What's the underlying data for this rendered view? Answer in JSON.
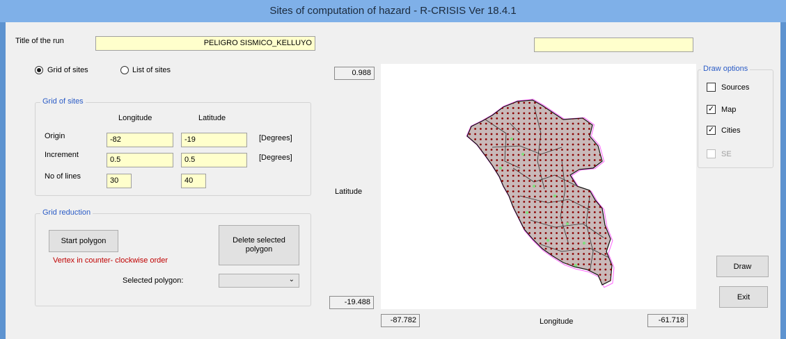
{
  "window": {
    "title": "Sites of computation of hazard - R-CRISIS Ver 18.4.1"
  },
  "run": {
    "label": "Title of the run",
    "value": "PELIGRO SISMICO_KELLUYO",
    "secondary_value": ""
  },
  "mode": {
    "grid_label": "Grid of sites",
    "list_label": "List of sites",
    "selected": "grid"
  },
  "grid": {
    "title": "Grid of sites",
    "col_longitude": "Longitude",
    "col_latitude": "Latitude",
    "rows": [
      {
        "label": "Origin",
        "lon": "-82",
        "lat": "-19",
        "unit": "[Degrees]"
      },
      {
        "label": "Increment",
        "lon": "0.5",
        "lat": "0.5",
        "unit": "[Degrees]"
      },
      {
        "label": "No of lines",
        "lon": "30",
        "lat": "40",
        "unit": ""
      }
    ]
  },
  "reduction": {
    "title": "Grid reduction",
    "start_polygon": "Start polygon",
    "vertex_note": "Vertex in counter- clockwise order",
    "delete_polygon": "Delete selected polygon",
    "selected_label": "Selected polygon:",
    "selected_value": ""
  },
  "map": {
    "lat_max": "0.988",
    "lat_min": "-19.488",
    "lat_label": "Latitude",
    "lon_min": "-87.782",
    "lon_max": "-61.718",
    "lon_label": "Longitude",
    "fill_color": "#c9b9b9",
    "site_color": "#8b0000",
    "outline_color": "#ff66ff",
    "city_color": "#7ee07e"
  },
  "draw_options": {
    "title": "Draw options",
    "items": [
      {
        "label": "Sources",
        "checked": false,
        "enabled": true
      },
      {
        "label": "Map",
        "checked": true,
        "enabled": true
      },
      {
        "label": "Cities",
        "checked": true,
        "enabled": true
      },
      {
        "label": "SE",
        "checked": false,
        "enabled": false
      }
    ]
  },
  "buttons": {
    "draw": "Draw",
    "exit": "Exit"
  }
}
